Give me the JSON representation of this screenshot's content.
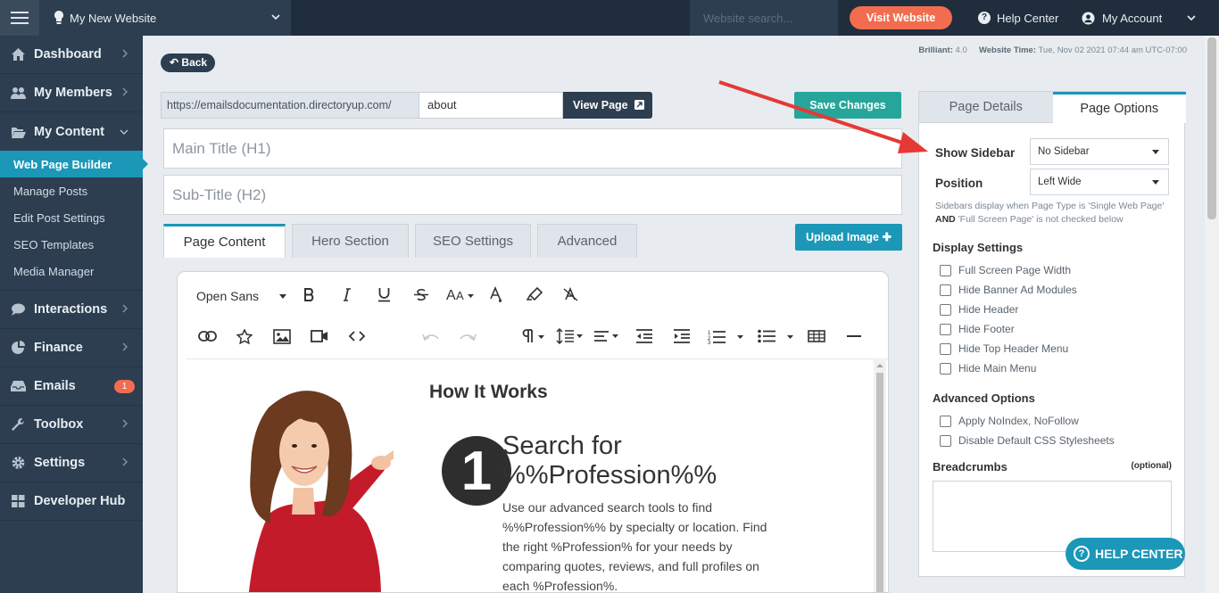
{
  "topbar": {
    "site_name": "My New Website",
    "search_placeholder": "Website search...",
    "visit_label": "Visit Website",
    "help_label": "Help Center",
    "account_label": "My Account"
  },
  "sidebar": {
    "items": [
      {
        "label": "Dashboard"
      },
      {
        "label": "My Members"
      },
      {
        "label": "My Content"
      }
    ],
    "content_sub": [
      {
        "label": "Web Page Builder"
      },
      {
        "label": "Manage Posts"
      },
      {
        "label": "Edit Post Settings"
      },
      {
        "label": "SEO Templates"
      },
      {
        "label": "Media Manager"
      }
    ],
    "items_after": [
      {
        "label": "Interactions"
      },
      {
        "label": "Finance"
      },
      {
        "label": "Emails",
        "badge": "1"
      },
      {
        "label": "Toolbox"
      },
      {
        "label": "Settings"
      },
      {
        "label": "Developer Hub"
      }
    ]
  },
  "meta": {
    "version_label": "Brilliant:",
    "version": "4.0",
    "time_label": "Website Time:",
    "time": "Tue, Nov 02 2021 07:44 am UTC-07:00"
  },
  "page": {
    "back_label": "Back",
    "url_prefix": "https://emailsdocumentation.directoryup.com/",
    "url_slug": "about",
    "view_label": "View Page",
    "save_label": "Save Changes",
    "main_title_placeholder": "Main Title (H1)",
    "subtitle_placeholder": "Sub-Title (H2)",
    "tabs": [
      "Page Content",
      "Hero Section",
      "SEO Settings",
      "Advanced"
    ],
    "upload_label": "Upload Image"
  },
  "editor": {
    "font": "Open Sans",
    "heading": "How It Works",
    "step_number": "1",
    "step_title": "Search for %%Profession%%",
    "step_desc": "Use our advanced search tools to find %%Profession%% by specialty or location. Find the right %Profession% for your needs by comparing quotes, reviews, and full profiles on each %Profession%."
  },
  "options": {
    "tabs": [
      "Page Details",
      "Page Options"
    ],
    "show_sidebar_label": "Show Sidebar",
    "show_sidebar_value": "No Sidebar",
    "position_label": "Position",
    "position_value": "Left Wide",
    "note_a": "Sidebars display when Page Type is 'Single Web Page' ",
    "note_and": "AND",
    "note_b": " 'Full Screen Page' is not checked below",
    "display_heading": "Display Settings",
    "display_options": [
      "Full Screen Page Width",
      "Hide Banner Ad Modules",
      "Hide Header",
      "Hide Footer",
      "Hide Top Header Menu",
      "Hide Main Menu"
    ],
    "advanced_heading": "Advanced Options",
    "advanced_options": [
      "Apply NoIndex, NoFollow",
      "Disable Default CSS Stylesheets"
    ],
    "breadcrumbs_label": "Breadcrumbs",
    "optional_label": "(optional)"
  },
  "help_float": "HELP CENTER",
  "colors": {
    "topbar": "#1f2d3d",
    "sidebar": "#2c3e50",
    "accent": "#1b97b8",
    "save": "#26a69a",
    "visit": "#f26c4f",
    "arrow": "#e53935"
  }
}
